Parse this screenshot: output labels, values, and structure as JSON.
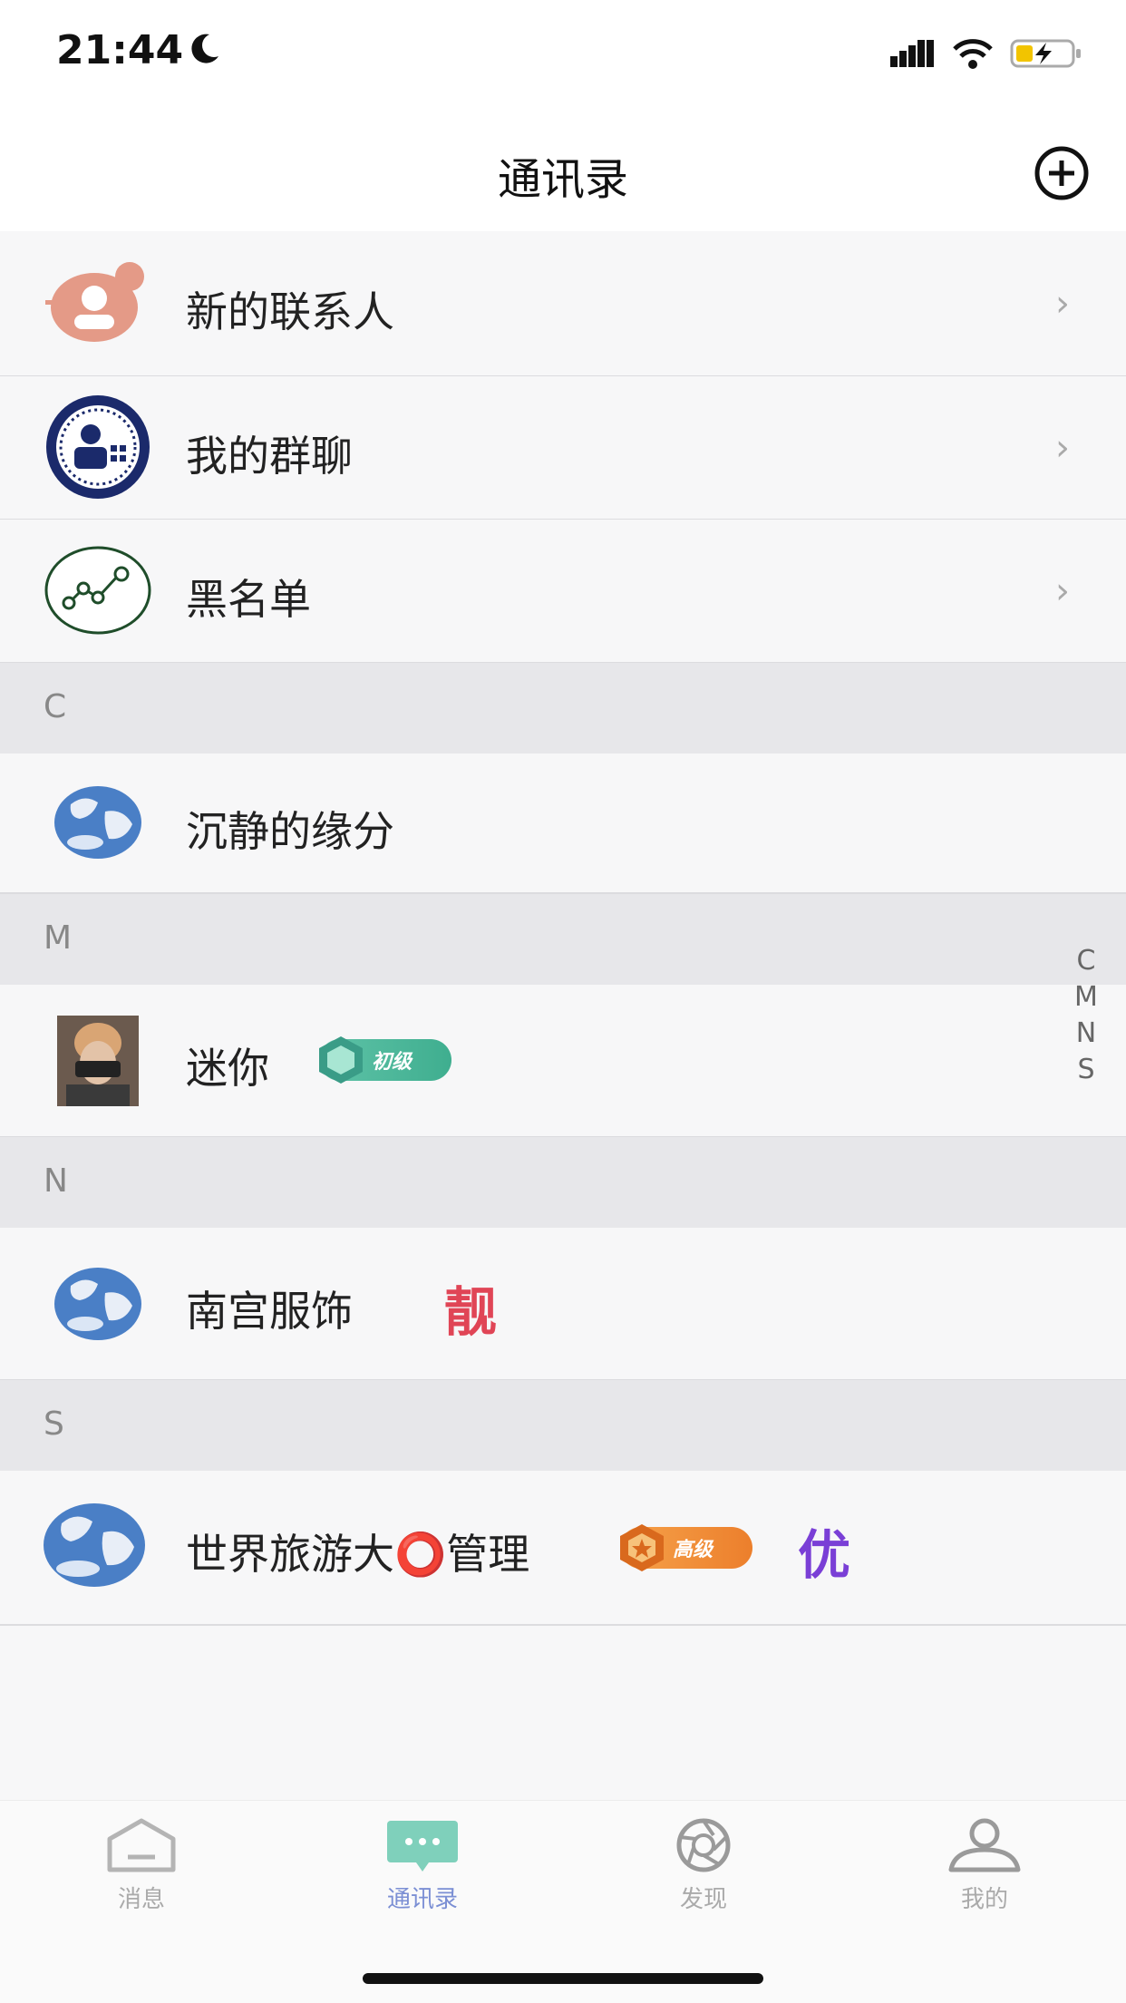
{
  "status_bar": {
    "time": "21:44"
  },
  "header": {
    "title": "通讯录"
  },
  "menu_items": [
    {
      "label": "新的联系人",
      "icon": "new-contact-icon"
    },
    {
      "label": "我的群聊",
      "icon": "group-chat-icon"
    },
    {
      "label": "黑名单",
      "icon": "blacklist-icon"
    }
  ],
  "sections": [
    {
      "letter": "C",
      "contacts": [
        {
          "name": "沉静的缘分",
          "avatar": "globe-avatar"
        }
      ]
    },
    {
      "letter": "M",
      "contacts": [
        {
          "name": "迷你",
          "avatar": "photo-avatar",
          "level_badge": "初级"
        }
      ]
    },
    {
      "letter": "N",
      "contacts": [
        {
          "name": "南宫服饰",
          "avatar": "globe-avatar",
          "char_badge": "靓"
        }
      ]
    },
    {
      "letter": "S",
      "contacts": [
        {
          "name": "世界旅游大⭕管理",
          "avatar": "globe-avatar",
          "level_badge": "高级",
          "char_badge": "优"
        }
      ]
    }
  ],
  "index_letters": [
    "C",
    "M",
    "N",
    "S"
  ],
  "tabs": [
    {
      "label": "消息",
      "icon": "home-icon",
      "active": false
    },
    {
      "label": "通讯录",
      "icon": "chat-bubble-icon",
      "active": true
    },
    {
      "label": "发现",
      "icon": "aperture-icon",
      "active": false
    },
    {
      "label": "我的",
      "icon": "user-icon",
      "active": false
    }
  ],
  "colors": {
    "accent": "#7b8fd4",
    "badge_green": "#4fbf9f",
    "badge_orange": "#f0913a",
    "char_red": "#e04556",
    "char_purple": "#7a3fd6"
  }
}
